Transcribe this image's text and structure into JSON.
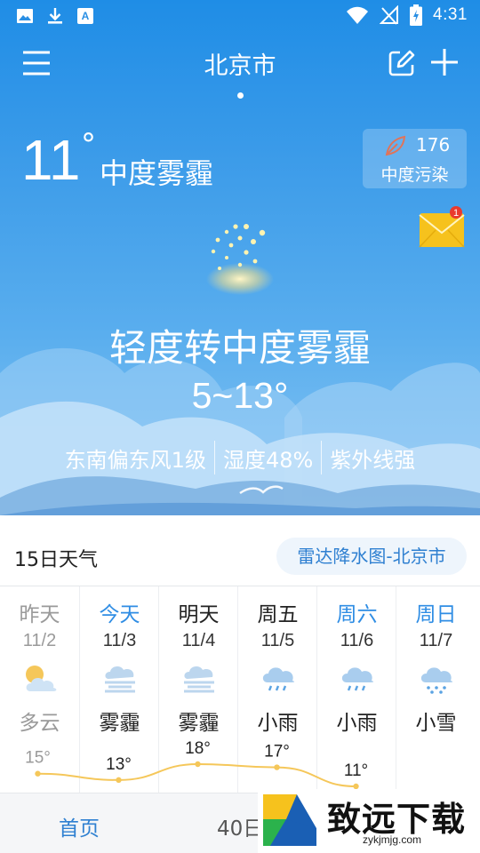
{
  "status_bar": {
    "time": "4:31",
    "left_icons": [
      "gallery-icon",
      "download-icon",
      "font-icon"
    ],
    "right_icons": [
      "wifi-icon",
      "no-signal-icon",
      "battery-icon"
    ]
  },
  "header": {
    "city": "北京市",
    "icons": {
      "menu": "menu-icon",
      "edit": "edit-icon",
      "add": "add-icon"
    }
  },
  "current": {
    "temperature": "11",
    "degree_symbol": "°",
    "condition": "中度雾霾",
    "aqi": {
      "value": "176",
      "label": "中度污染",
      "icon": "leaf-icon"
    },
    "mail_badge": "1"
  },
  "today": {
    "description": "轻度转中度雾霾",
    "range": "5~13°",
    "wind": "东南偏东风1级",
    "humidity": "湿度48%",
    "uv": "紫外线强"
  },
  "forecast_section": {
    "title": "15日天气",
    "radar_button": "雷达降水图-北京市"
  },
  "days": [
    {
      "name": "昨天",
      "date": "11/2",
      "condition": "多云",
      "icon": "partly-cloudy-icon",
      "high": "15°",
      "high_value": 15,
      "past": true,
      "weekend": false
    },
    {
      "name": "今天",
      "date": "11/3",
      "condition": "雾霾",
      "icon": "haze-icon",
      "high": "13°",
      "high_value": 13,
      "past": false,
      "weekend": false,
      "today": true
    },
    {
      "name": "明天",
      "date": "11/4",
      "condition": "雾霾",
      "icon": "haze-icon",
      "high": "18°",
      "high_value": 18,
      "past": false,
      "weekend": false
    },
    {
      "name": "周五",
      "date": "11/5",
      "condition": "小雨",
      "icon": "light-rain-icon",
      "high": "17°",
      "high_value": 17,
      "past": false,
      "weekend": false
    },
    {
      "name": "周六",
      "date": "11/6",
      "condition": "小雨",
      "icon": "light-rain-icon",
      "high": "11°",
      "high_value": 11,
      "past": false,
      "weekend": true
    },
    {
      "name": "周日",
      "date": "11/7",
      "condition": "小雪",
      "icon": "light-snow-icon",
      "high": "",
      "high_value": null,
      "past": false,
      "weekend": true
    }
  ],
  "bottom_nav": {
    "home": "首页",
    "forty_day": "40日"
  },
  "watermark": {
    "text": "致远下载",
    "url": "zykjmjg.com"
  },
  "colors": {
    "sky_top": "#1f8de6",
    "accent_blue": "#2f80d1",
    "curve": "#f5c75a"
  }
}
